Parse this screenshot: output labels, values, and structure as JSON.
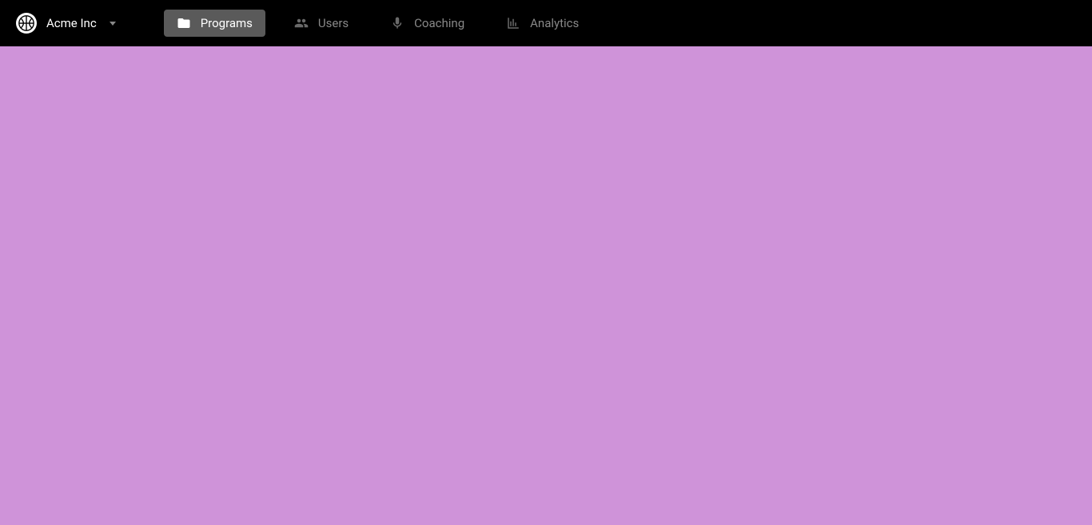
{
  "brand": {
    "name": "Acme Inc"
  },
  "nav": {
    "items": [
      {
        "label": "Programs",
        "icon": "folder-icon",
        "active": true
      },
      {
        "label": "Users",
        "icon": "users-icon",
        "active": false
      },
      {
        "label": "Coaching",
        "icon": "microphone-icon",
        "active": false
      },
      {
        "label": "Analytics",
        "icon": "bar-chart-icon",
        "active": false
      }
    ]
  },
  "colors": {
    "navbar_bg": "#000000",
    "content_bg": "#cf93d9",
    "nav_active_bg": "#5a5a5a",
    "nav_inactive_text": "#888888"
  }
}
